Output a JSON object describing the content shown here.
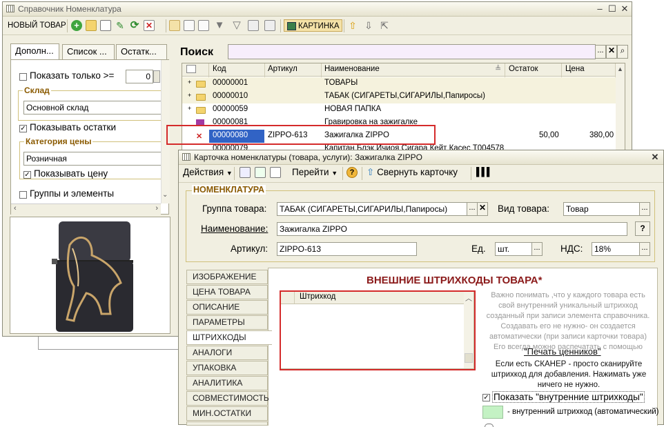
{
  "main_window": {
    "title": "Справочник Номенклатура",
    "toolbar": {
      "new_item": "НОВЫЙ ТОВАР",
      "picture_btn": "КАРТИНКА"
    },
    "left_tabs": [
      "Дополн...",
      "Список ...",
      "Остатк..."
    ],
    "filters": {
      "show_only_label": "Показать только  >=",
      "show_only_value": "0",
      "warehouse_group": "Склад",
      "warehouse_value": "Основной склад",
      "show_balance": "Показывать остатки",
      "price_category_group": "Категория цены",
      "price_category_value": "Розничная",
      "show_price": "Показывать цену",
      "groups_elements": "Группы и элементы"
    },
    "search_label": "Поиск",
    "search_value": "",
    "grid": {
      "columns": [
        "Код",
        "Артикул",
        "Наименование",
        "Остаток",
        "Цена"
      ],
      "rows": [
        {
          "code": "00000001",
          "article": "",
          "name": "ТОВАРЫ",
          "balance": "",
          "price": ""
        },
        {
          "code": "00000010",
          "article": "",
          "name": "ТАБАК (СИГАРЕТЫ,СИГАРИЛЫ,Папиросы)",
          "balance": "",
          "price": ""
        },
        {
          "code": "00000059",
          "article": "",
          "name": "НОВАЯ ПАПКА",
          "balance": "",
          "price": ""
        },
        {
          "code": "00000081",
          "article": "",
          "name": "Гравировка на зажигалке",
          "balance": "",
          "price": ""
        },
        {
          "code": "00000080",
          "article": "ZIPPO-613",
          "name": "Зажигалка ZIPPO",
          "balance": "50,00",
          "price": "380,00"
        },
        {
          "code": "00000079",
          "article": "",
          "name": "Капитан Блэк Ичиоя Сигара Кейт Касес Т004578",
          "balance": "",
          "price": ""
        }
      ]
    }
  },
  "card": {
    "title": "Карточка номенклатуры (товара, услуги): Зажигалка ZIPPO",
    "toolbar": {
      "actions": "Действия",
      "go_to": "Перейти",
      "collapse": "Свернуть карточку"
    },
    "group_title": "НОМЕНКЛАТУРА",
    "fields": {
      "group_label": "Группа товара:",
      "group_value": "ТАБАК (СИГАРЕТЫ,СИГАРИЛЫ,Папиросы)",
      "kind_label": "Вид товара:",
      "kind_value": "Товар",
      "name_label": "Наименование:",
      "name_value": "Зажигалка ZIPPO",
      "article_label": "Артикул:",
      "article_value": "ZIPPO-613",
      "unit_label": "Ед.",
      "unit_value": "шт.",
      "vat_label": "НДС:",
      "vat_value": "18%"
    },
    "side_tabs": [
      "ИЗОБРАЖЕНИЕ",
      "ЦЕНА ТОВАРА",
      "ОПИСАНИЕ",
      "ПАРАМЕТРЫ",
      "ШТРИХКОДЫ",
      "АНАЛОГИ",
      "УПАКОВКА",
      "АНАЛИТИКА",
      "СОВМЕСТИМОСТЬ",
      "МИН.ОСТАТКИ"
    ],
    "barcodes": {
      "heading": "ВНЕШНИЕ ШТРИХКОДЫ ТОВАРА*",
      "column": "Штрихкод",
      "note1": "Важно понимать ,что у каждого товара есть свой внутренний уникальный штрихкод созданный при записи элемента справочника. Создавать его не нужно- он создается автоматически (при записи карточки товара) Его всегда можно распечатать с помощью",
      "print_link": "\"Печать ценников\"",
      "note2": "Если есть СКАНЕР - просто сканируйте штрихкод для добавления. Нажимать уже ничего не нужно.",
      "show_internal": "Показать \"внутренние штрихкоды\"",
      "legend": "- внутренний штрихкод (автоматический)"
    }
  },
  "colors": {
    "highlight": "#d42a2a",
    "selected_row": "#3163c5",
    "heading": "#8b1a1a",
    "accent_orange": "#8a5a00"
  }
}
